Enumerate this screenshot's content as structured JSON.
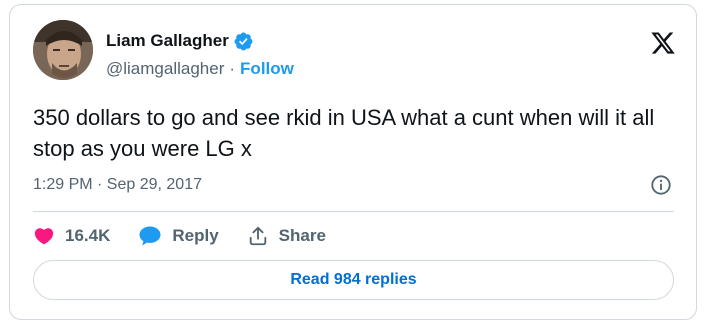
{
  "author": {
    "display_name": "Liam Gallagher",
    "handle": "@liamgallagher",
    "verified": true,
    "avatar_icon": "avatar-photo"
  },
  "header": {
    "separator": "·",
    "follow_label": "Follow",
    "logo_icon": "x-logo-icon"
  },
  "tweet": {
    "text": "350 dollars to go and see rkid in USA what a cunt when will it all stop as you were LG x",
    "timestamp": "1:29 PM · Sep 29, 2017"
  },
  "actions": {
    "likes": {
      "icon": "heart-icon",
      "label": "16.4K",
      "color": "#f91880"
    },
    "reply": {
      "icon": "speech-bubble-icon",
      "label": "Reply",
      "color": "#1d9bf0"
    },
    "share": {
      "icon": "share-upload-icon",
      "label": "Share"
    }
  },
  "footer": {
    "read_replies_label": "Read 984 replies"
  },
  "colors": {
    "accent": "#1d9bf0",
    "text_primary": "#0f1419",
    "text_secondary": "#536471",
    "border": "#cfd9de",
    "like": "#f91880"
  }
}
